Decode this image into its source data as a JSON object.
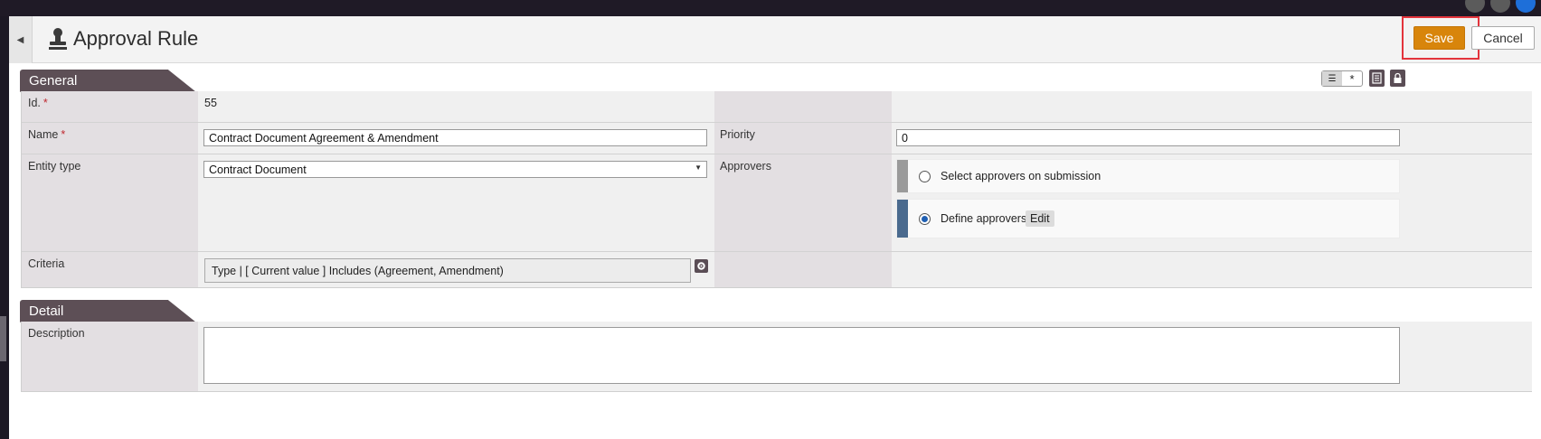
{
  "header": {
    "title": "Approval Rule",
    "save_label": "Save",
    "cancel_label": "Cancel"
  },
  "general": {
    "section_title": "General",
    "id_label": "Id.",
    "id_value": "55",
    "name_label": "Name",
    "name_value": "Contract Document Agreement & Amendment",
    "priority_label": "Priority",
    "priority_value": "0",
    "entity_type_label": "Entity type",
    "entity_type_value": "Contract Document",
    "approvers_label": "Approvers",
    "approver_options": [
      {
        "label": "Select approvers on submission",
        "selected": false,
        "bar_color": "#9a9a9a"
      },
      {
        "label": "Define approvers",
        "selected": true,
        "bar_color": "#4a6a8e"
      }
    ],
    "edit_label": "Edit",
    "criteria_label": "Criteria",
    "criteria_value": "Type | [ Current value ] Includes (Agreement, Amendment)",
    "required_mark": "*"
  },
  "detail": {
    "section_title": "Detail",
    "description_label": "Description",
    "description_value": ""
  },
  "icons": {
    "page": "stamp-icon",
    "collapse": "triangle-left-icon",
    "list_view": "list-icon",
    "asterisk": "asterisk-icon",
    "notes": "notes-icon",
    "lock": "lock-icon",
    "gear": "gear-icon"
  },
  "colors": {
    "save": "#d8850b",
    "highlight": "#e3343c",
    "section_tab": "#5d4f56",
    "radio_selected": "#1f5fb2"
  }
}
